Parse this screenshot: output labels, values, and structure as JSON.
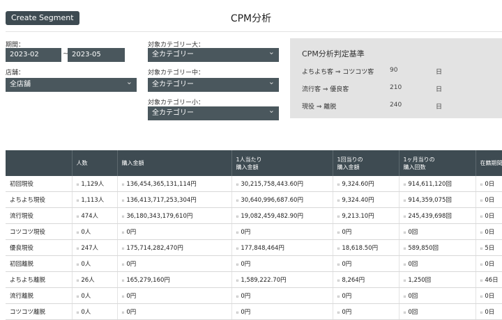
{
  "header": {
    "create_button": "Create Segment",
    "title": "CPM分析"
  },
  "filters": {
    "period_label": "期間：",
    "period_from": "2023-02",
    "period_sep": "~",
    "period_to": "2023-05",
    "store_label": "店舗：",
    "store_value": "全店舗",
    "cat_large_label": "対象カテゴリー大：",
    "cat_large_value": "全カテゴリー",
    "cat_mid_label": "対象カテゴリー中：",
    "cat_mid_value": "全カテゴリー",
    "cat_small_label": "対象カテゴリー小：",
    "cat_small_value": "全カテゴリー"
  },
  "criteria": {
    "title": "CPM分析判定基準",
    "rows": [
      {
        "label": "よちよち客 ⇒ コツコツ客",
        "value": "90",
        "unit": "日"
      },
      {
        "label": "流行客 ⇒ 優良客",
        "value": "210",
        "unit": "日"
      },
      {
        "label": "現役 ⇒ 離脱",
        "value": "240",
        "unit": "日"
      }
    ]
  },
  "table": {
    "headers": [
      {
        "l1": "",
        "l2": ""
      },
      {
        "l1": "人数",
        "l2": ""
      },
      {
        "l1": "購入金額",
        "l2": ""
      },
      {
        "l1": "1人当たり",
        "l2": "購入金額"
      },
      {
        "l1": "1回当りの",
        "l2": "購入金額"
      },
      {
        "l1": "1ヶ月当りの",
        "l2": "購入回数"
      },
      {
        "l1": "在籍期間",
        "l2": ""
      }
    ],
    "tag": "¤",
    "rows": [
      {
        "name": "初回現役",
        "count": "1,129人",
        "amount": "136,454,365,131,114円",
        "per_person": "30,215,758,443.60円",
        "per_time": "9,324.60円",
        "per_month": "914,611,120回",
        "tenure": "0日"
      },
      {
        "name": "よちよち現役",
        "count": "1,113人",
        "amount": "136,413,717,253,304円",
        "per_person": "30,640,996,687.60円",
        "per_time": "9,324.40円",
        "per_month": "914,359,075回",
        "tenure": "0日"
      },
      {
        "name": "流行現役",
        "count": "474人",
        "amount": "36,180,343,179,610円",
        "per_person": "19,082,459,482.90円",
        "per_time": "9,213.10円",
        "per_month": "245,439,698回",
        "tenure": "0日"
      },
      {
        "name": "コツコツ現役",
        "count": "0人",
        "amount": "0円",
        "per_person": "0円",
        "per_time": "0円",
        "per_month": "0回",
        "tenure": "0日"
      },
      {
        "name": "優良現役",
        "count": "247人",
        "amount": "175,714,282,470円",
        "per_person": "177,848,464円",
        "per_time": "18,618.50円",
        "per_month": "589,850回",
        "tenure": "5日"
      },
      {
        "name": "初回離脱",
        "count": "0人",
        "amount": "0円",
        "per_person": "0円",
        "per_time": "0円",
        "per_month": "0回",
        "tenure": "0日"
      },
      {
        "name": "よちよち離脱",
        "count": "26人",
        "amount": "165,279,160円",
        "per_person": "1,589,222.70円",
        "per_time": "8,264円",
        "per_month": "1,250回",
        "tenure": "46日"
      },
      {
        "name": "流行離脱",
        "count": "0人",
        "amount": "0円",
        "per_person": "0円",
        "per_time": "0円",
        "per_month": "0回",
        "tenure": "0日"
      },
      {
        "name": "コツコツ離脱",
        "count": "0人",
        "amount": "0円",
        "per_person": "0円",
        "per_time": "0円",
        "per_month": "0回",
        "tenure": "0日"
      }
    ]
  }
}
